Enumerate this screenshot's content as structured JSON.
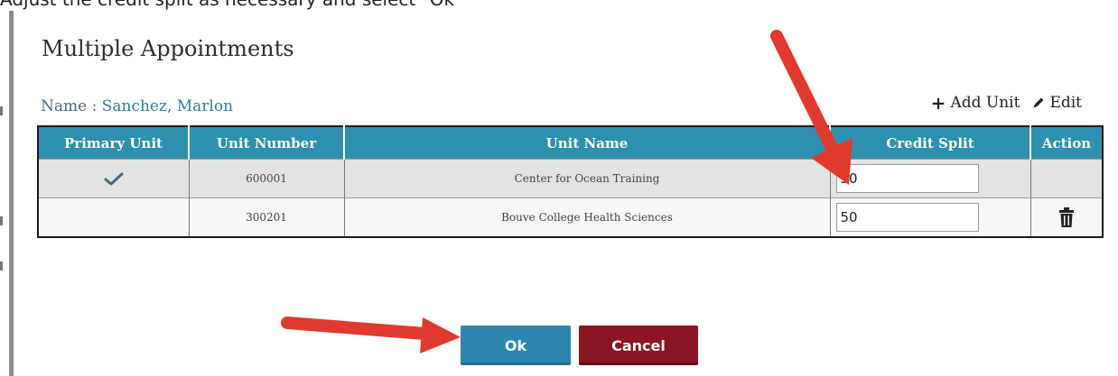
{
  "instruction": "Adjust the credit split as necessary and select \"Ok\"",
  "dialog": {
    "title": "Multiple Appointments",
    "name_label": "Name :",
    "name_value": "Sanchez, Marlon",
    "add_unit_label": "Add Unit",
    "edit_label": "Edit"
  },
  "table": {
    "headers": [
      "Primary Unit",
      "Unit Number",
      "Unit Name",
      "Credit Split",
      "Action"
    ],
    "rows": [
      {
        "primary": true,
        "unit_number": "600001",
        "unit_name": "Center for Ocean Training",
        "credit_split": "50",
        "deletable": false
      },
      {
        "primary": false,
        "unit_number": "300201",
        "unit_name": "Bouve College Health Sciences",
        "credit_split": "50",
        "deletable": true
      }
    ]
  },
  "buttons": {
    "ok": "Ok",
    "cancel": "Cancel"
  },
  "colors": {
    "header_bg": "#2f8fae",
    "ok_bg": "#2d86ae",
    "cancel_bg": "#8b1522",
    "arrow": "#e03a2f",
    "name_text": "#2c7f95"
  },
  "icons": [
    "plus-icon",
    "pencil-icon",
    "check-icon",
    "trash-icon",
    "annotation-arrow"
  ]
}
